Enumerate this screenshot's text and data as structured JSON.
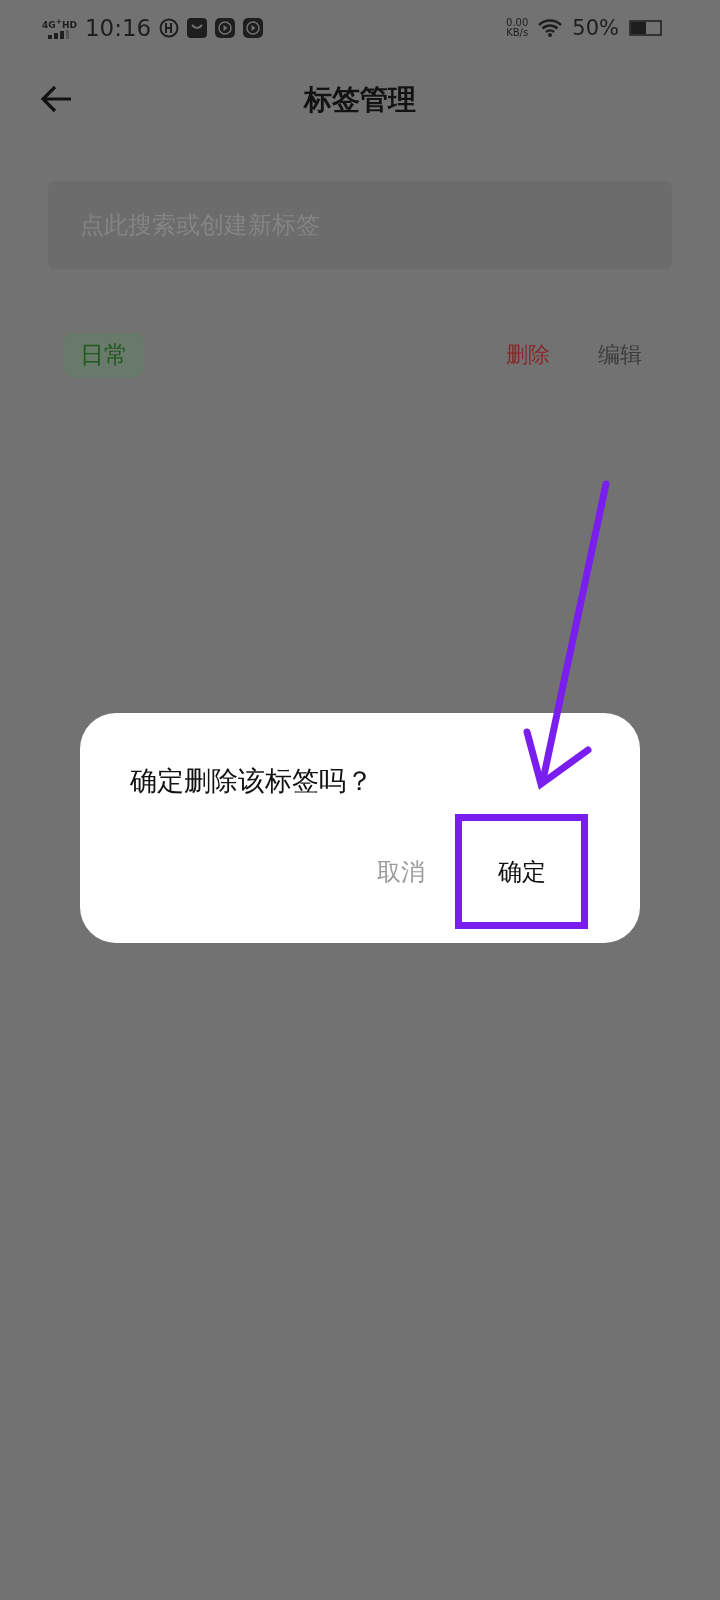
{
  "status_bar": {
    "network": "4G$^{+}$HD",
    "time": "10:16",
    "speed": "0.00",
    "speed_unit": "KB/s",
    "battery": "50%"
  },
  "header": {
    "title": "标签管理"
  },
  "search": {
    "placeholder": "点此搜索或创建新标签"
  },
  "tags": [
    {
      "label": "日常"
    }
  ],
  "actions": [
    {
      "label": "删除",
      "kind": "delete"
    },
    {
      "label": "编辑",
      "kind": "edit"
    }
  ],
  "dialog": {
    "message": "确定删除该标签吗？",
    "buttons": [
      {
        "label": "取消",
        "kind": "cancel",
        "highlighted": false
      },
      {
        "label": "确定",
        "kind": "confirm",
        "highlighted": true
      }
    ]
  }
}
